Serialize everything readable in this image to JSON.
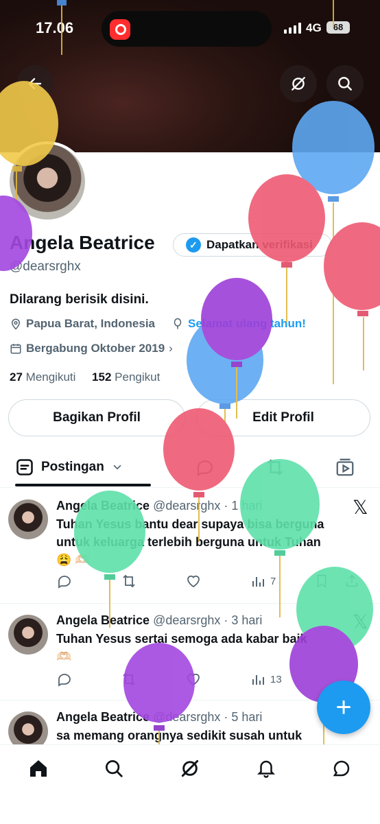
{
  "status_bar": {
    "time": "17.06",
    "network": "4G",
    "battery": "68"
  },
  "profile": {
    "name": "Angela Beatrice",
    "verify_label": "Dapatkan verifikasi",
    "handle": "@dearsrghx",
    "bio": "Dilarang berisik disini.",
    "location": "Papua Barat, Indonesia",
    "birthday": "Selamat ulang tahun!",
    "joined": "Bergabung Oktober 2019",
    "following_count": "27",
    "following_label": "Mengikuti",
    "followers_count": "152",
    "followers_label": "Pengikut"
  },
  "buttons": {
    "share_profile": "Bagikan Profil",
    "edit_profile": "Edit Profil"
  },
  "tabs": {
    "posts_label": "Postingan"
  },
  "posts": [
    {
      "name": "Angela Beatrice",
      "meta": "@dearsrghx · 1 hari",
      "line1": "Tuhan Yesus bantu dear supaya bisa berguna",
      "line2": "untuk keluarga terlebih berguna untuk Tuhan",
      "emoji": "😩 🫶🏻",
      "views": "7"
    },
    {
      "name": "Angela Beatrice",
      "meta": "@dearsrghx · 3 hari",
      "line1": "Tuhan Yesus sertai semoga ada kabar baik",
      "emoji": "🫶🏻",
      "views": "13"
    },
    {
      "name": "Angela Beatrice",
      "meta": "@dearsrghx · 5 hari",
      "line1": "sa memang orangnya sedikit susah untuk"
    }
  ],
  "colors": {
    "accent": "#1d9bf0",
    "text": "#0f1419",
    "muted": "#536471"
  },
  "icons": [
    "back-arrow-icon",
    "grok-icon",
    "search-icon",
    "verified-badge-icon",
    "location-icon",
    "balloon-icon",
    "calendar-icon",
    "post-tab-icon",
    "chevron-down-icon",
    "x-logo-icon",
    "reply-icon",
    "repost-icon",
    "like-icon",
    "views-icon",
    "bookmark-icon",
    "share-icon",
    "home-icon",
    "notifications-icon",
    "messages-icon",
    "plus-icon"
  ]
}
